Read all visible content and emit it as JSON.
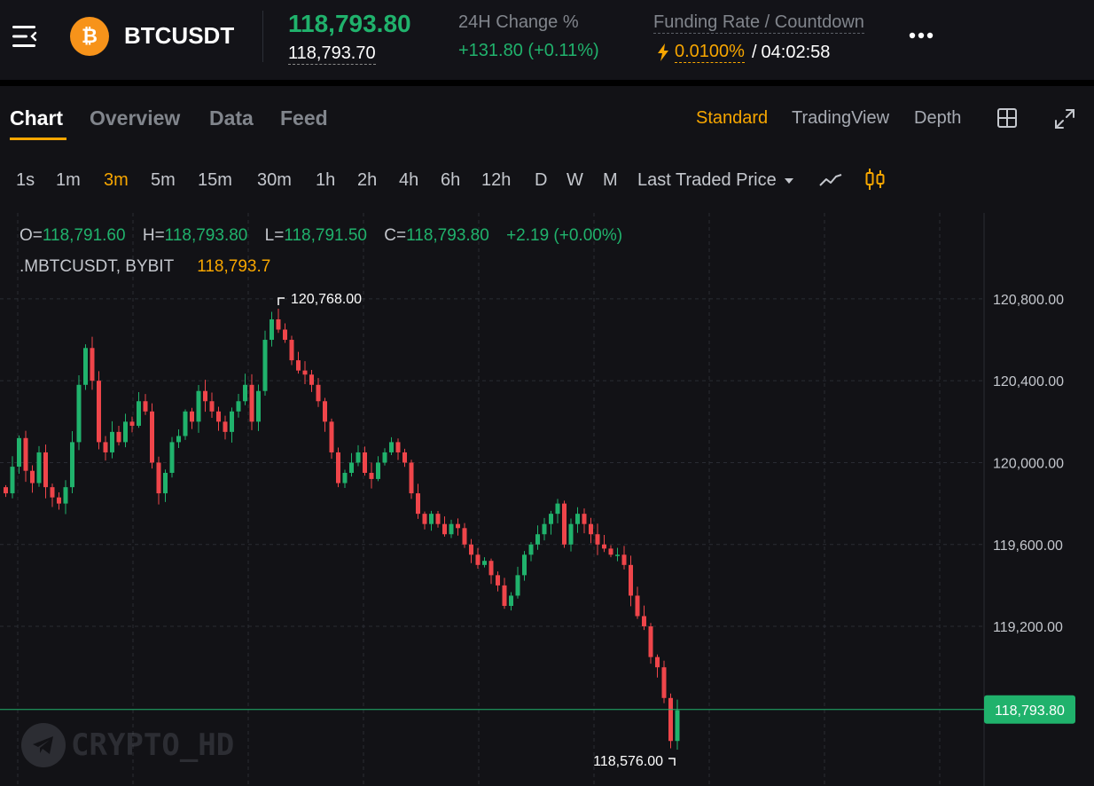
{
  "header": {
    "menu_icon": "menu-icon",
    "coin_icon": "bitcoin-icon",
    "coin_glyph": "₿",
    "symbol": "BTCUSDT",
    "last_price": "118,793.80",
    "mark_price": "118,793.70",
    "change_label": "24H Change %",
    "change_value": "+131.80 (+0.11%)",
    "funding_label": "Funding Rate / Countdown",
    "funding_icon": "lightning-icon",
    "funding_rate": "0.0100%",
    "countdown_sep": "/",
    "countdown": "04:02:58",
    "more_icon": "more-icon"
  },
  "tabs": [
    {
      "label": "Chart",
      "active": true
    },
    {
      "label": "Overview",
      "active": false
    },
    {
      "label": "Data",
      "active": false
    },
    {
      "label": "Feed",
      "active": false
    }
  ],
  "views": [
    {
      "label": "Standard",
      "active": true
    },
    {
      "label": "TradingView",
      "active": false
    },
    {
      "label": "Depth",
      "active": false
    }
  ],
  "view_icons": [
    "grid-layout-icon",
    "fullscreen-expand-icon"
  ],
  "timeframes": [
    {
      "label": "1s"
    },
    {
      "label": "1m"
    },
    {
      "label": "3m",
      "active": true
    },
    {
      "label": "5m"
    },
    {
      "label": "15m"
    },
    {
      "label": "30m"
    },
    {
      "label": "1h"
    },
    {
      "label": "2h"
    },
    {
      "label": "4h"
    },
    {
      "label": "6h"
    },
    {
      "label": "12h"
    },
    {
      "label": "D"
    },
    {
      "label": "W"
    },
    {
      "label": "M"
    }
  ],
  "price_type": {
    "label": "Last Traded Price",
    "icon": "caret-down-icon"
  },
  "chart_icons": [
    "line-chart-icon",
    "candlestick-icon"
  ],
  "ohlc": {
    "o_label": "O=",
    "o": "118,791.60",
    "h_label": "H=",
    "h": "118,793.80",
    "l_label": "L=",
    "l": "118,791.50",
    "c_label": "C=",
    "c": "118,793.80",
    "change": "+2.19 (+0.00%)"
  },
  "source": {
    "name": ".MBTCUSDT,  BYBIT",
    "price": "118,793.7"
  },
  "watermark": {
    "text": "CRYPTO_HD",
    "icon": "telegram-icon"
  },
  "colors": {
    "up": "#20b26c",
    "down": "#ef454a",
    "accent": "#f7a600",
    "background": "#121216"
  },
  "chart_data": {
    "type": "candlestick",
    "y_ticks": [
      120800,
      120400,
      120000,
      119600,
      119200
    ],
    "y_tick_labels": [
      "120,800.00",
      "120,400.00",
      "120,000.00",
      "119,600.00",
      "119,200.00"
    ],
    "ylim": [
      118420,
      121220
    ],
    "high_label": "120,768.00",
    "low_label": "118,576.00",
    "current_price": 118793.8,
    "current_price_label": "118,793.80",
    "grid": true,
    "close_series": [
      119850,
      119980,
      120120,
      119960,
      119900,
      120050,
      119880,
      119830,
      119800,
      119880,
      120100,
      120380,
      120560,
      120400,
      120100,
      120050,
      120150,
      120100,
      120200,
      120180,
      120300,
      120250,
      120000,
      119850,
      119950,
      120100,
      120130,
      120250,
      120200,
      120350,
      120300,
      120250,
      120200,
      120150,
      120250,
      120300,
      120380,
      120200,
      120350,
      120600,
      120700,
      120650,
      120600,
      120500,
      120450,
      120430,
      120380,
      120300,
      120200,
      120050,
      119900,
      119950,
      120000,
      120050,
      119950,
      119920,
      120000,
      120050,
      120100,
      120050,
      120000,
      119850,
      119750,
      119700,
      119750,
      119700,
      119650,
      119700,
      119680,
      119600,
      119550,
      119500,
      119520,
      119450,
      119400,
      119300,
      119350,
      119450,
      119550,
      119600,
      119650,
      119700,
      119750,
      119800,
      119600,
      119700,
      119750,
      119700,
      119650,
      119600,
      119580,
      119550,
      119550,
      119500,
      119350,
      119250,
      119200,
      119050,
      119000,
      118850,
      118640,
      118790
    ]
  }
}
